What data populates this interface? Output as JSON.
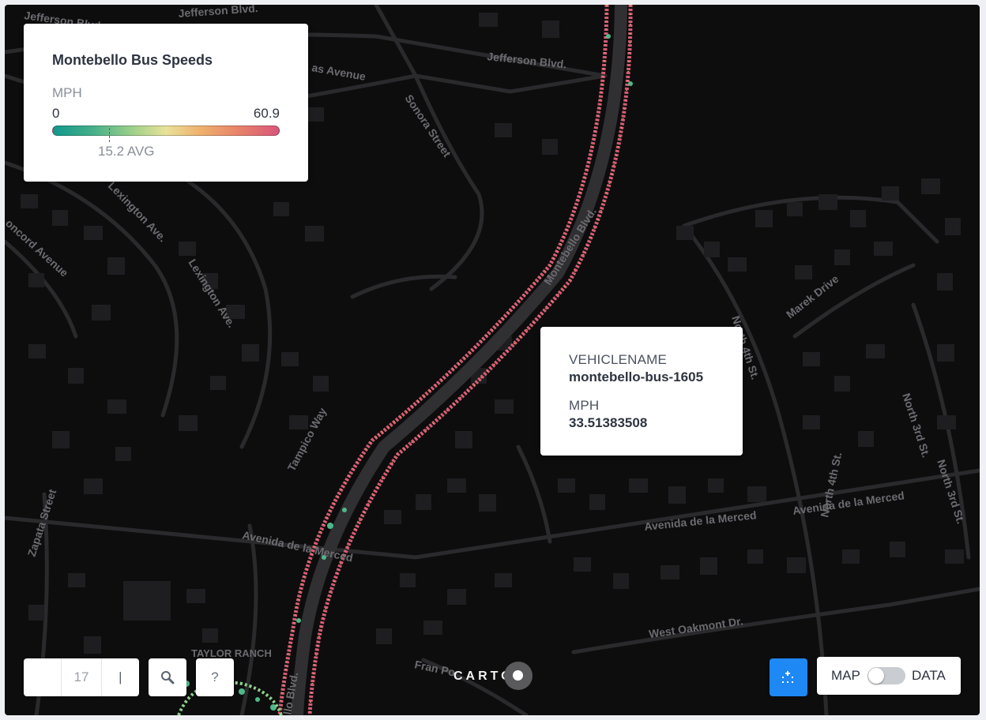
{
  "legend": {
    "title": "Montebello Bus Speeds",
    "unit": "MPH",
    "min": "0",
    "max": "60.9",
    "avg": "15.2 AVG",
    "ramp_colors": [
      "#12978c",
      "#9dd08a",
      "#e9e29a",
      "#e8836a",
      "#d9567a"
    ]
  },
  "popup": {
    "field1_label": "VEHICLENAME",
    "field1_value": "montebello-bus-1605",
    "field2_label": "MPH",
    "field2_value": "33.51383508"
  },
  "zoom": {
    "level": "17",
    "minus": "",
    "plus": "|"
  },
  "search": {
    "icon": "search-icon"
  },
  "help": {
    "label": "?"
  },
  "layers": {
    "icon": "layers-icon"
  },
  "view_toggle": {
    "map_label": "MAP",
    "data_label": "DATA",
    "state": "map"
  },
  "logo": {
    "text": "CARTO"
  },
  "map": {
    "background": "#0d0d0e",
    "street_labels": [
      "Jefferson Blvd.",
      "Jefferson Blvd.",
      "as Avenue",
      "Sonora Street",
      "Lexington Ave.",
      "Lexington Ave.",
      "oncord Avenue",
      "Montebello Blvd.",
      "Montebello Blvd.",
      "Tampico Way",
      "Zapata Street",
      "Avenida de la Merced",
      "Avenida de la Merced",
      "Avenida de la Merced",
      "North 4th St.",
      "North 4th St.",
      "Marek Drive",
      "North 3rd St.",
      "North 3rd St.",
      "West Oakmont Dr.",
      "TAYLOR RANCH",
      "Fran Po",
      "llo Blvd."
    ]
  }
}
